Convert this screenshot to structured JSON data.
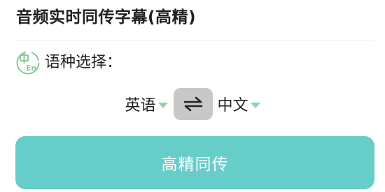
{
  "header": {
    "title": "音频实时同传字幕(高精)"
  },
  "language": {
    "label": "语种选择：",
    "icon": "zh-en-language-icon",
    "source": "英语",
    "target": "中文",
    "swap_icon": "swap-arrows-icon"
  },
  "actions": {
    "primary_label": "高精同传"
  },
  "colors": {
    "accent": "#67cdc9",
    "caret": "#8fd3a6",
    "swap_bg": "#c8c8c8",
    "icon_green": "#8bc79a"
  }
}
